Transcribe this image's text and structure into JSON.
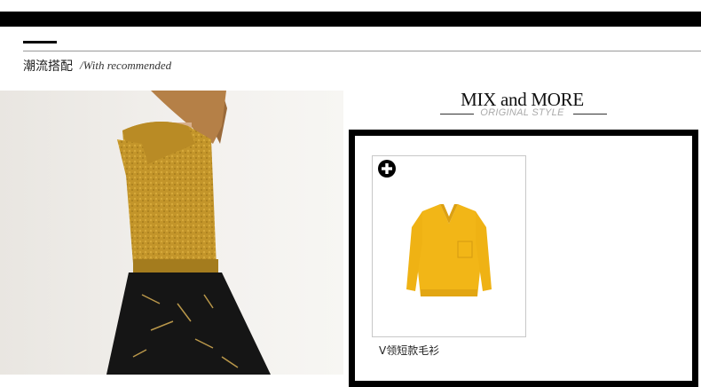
{
  "section": {
    "title": "潮流搭配",
    "subtitle": "/With recommended"
  },
  "mix": {
    "title": "MIX and MORE",
    "subtitle": "ORIGINAL STYLE"
  },
  "product": {
    "name": "V领短款毛衫",
    "icon": "plus-circle-icon",
    "color": "#f0b418"
  },
  "colors": {
    "topbar": "#000000",
    "sweater_mustard": "#c99a22"
  }
}
